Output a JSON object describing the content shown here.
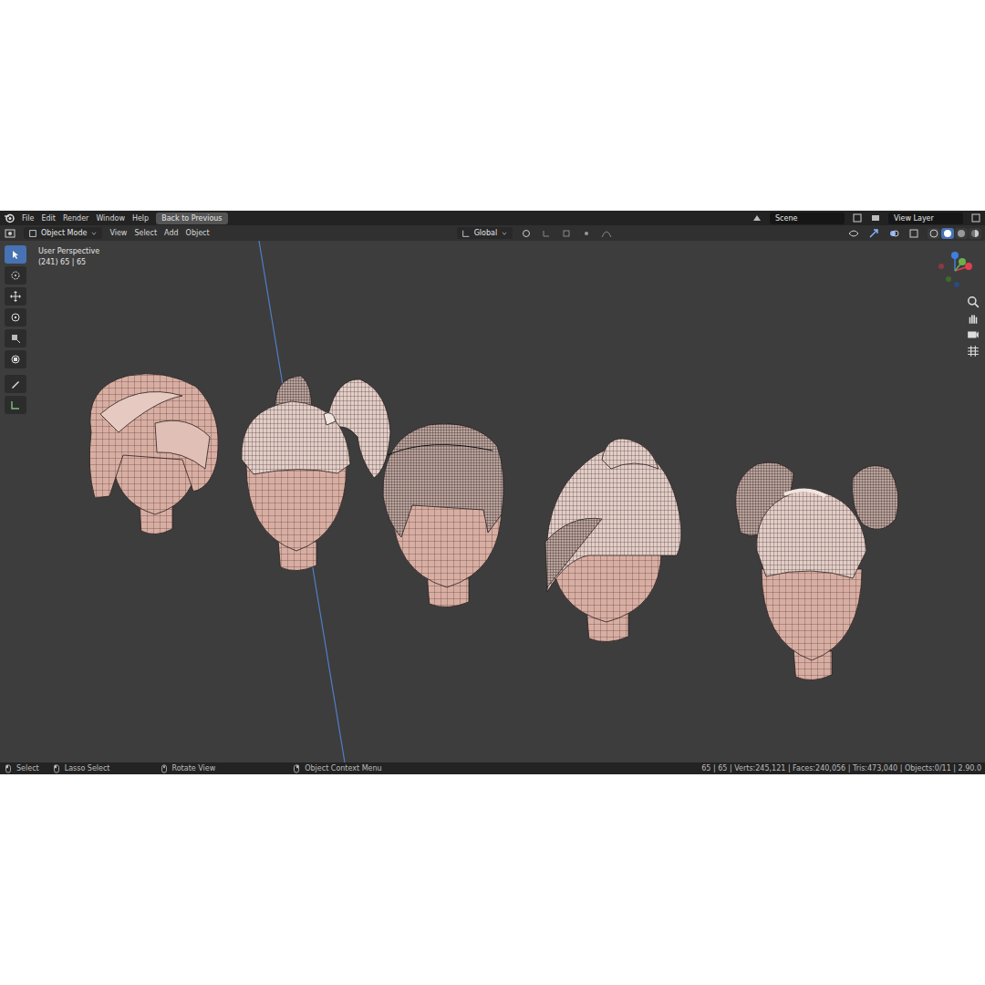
{
  "menu": [
    "File",
    "Edit",
    "Render",
    "Window",
    "Help"
  ],
  "back_button": "Back to Previous",
  "scene": "Scene",
  "view_layer": "View Layer",
  "mode": "Object Mode",
  "header_menu": [
    "View",
    "Select",
    "Add",
    "Object"
  ],
  "orientation": "Global",
  "shading": [
    {
      "selected": false
    },
    {
      "selected": true
    },
    {
      "selected": false
    },
    {
      "selected": false
    }
  ],
  "tools": [
    {
      "selected": true
    },
    {
      "selected": false
    },
    {
      "selected": false
    },
    {
      "selected": false
    },
    {
      "selected": false
    },
    {
      "selected": false
    },
    {
      "selected": false
    },
    {
      "selected": false
    }
  ],
  "viewport": {
    "title": "User Perspective",
    "info": "(241) 65 | 65"
  },
  "status_bar": {
    "hints": [
      "Select",
      "Lasso Select",
      "Rotate View",
      "Object Context Menu"
    ],
    "stats": "65 | 65 | Verts:245,121 | Faces:240,056 | Tris:473,040 | Objects:0/11 | 2.90.0"
  }
}
